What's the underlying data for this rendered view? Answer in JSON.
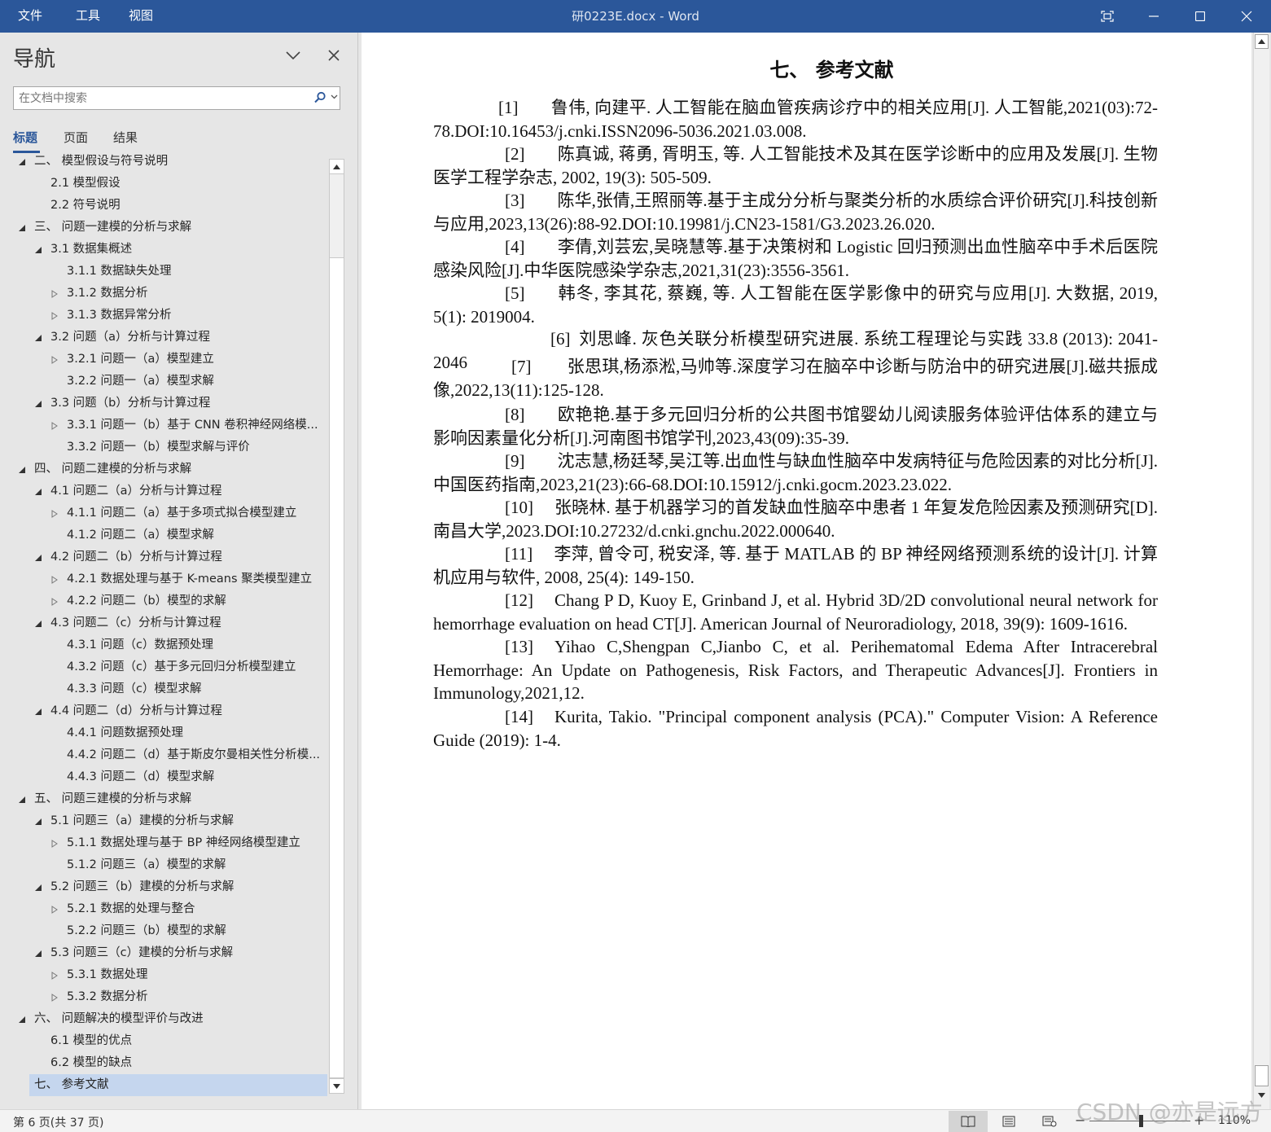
{
  "titlebar": {
    "menus": [
      "文件",
      "工具",
      "视图"
    ],
    "doc_title": "研0223E.docx  -  Word",
    "accent": "#2b579a"
  },
  "nav": {
    "title": "导航",
    "search_placeholder": "在文档中搜索",
    "tabs": [
      "标题",
      "页面",
      "结果"
    ],
    "tree": [
      {
        "label": "二、 模型假设与符号说明",
        "level": 1,
        "toggle": "expanded"
      },
      {
        "label": "2.1 模型假设",
        "level": 2,
        "toggle": "none"
      },
      {
        "label": "2.2 符号说明",
        "level": 2,
        "toggle": "none"
      },
      {
        "label": "三、 问题一建模的分析与求解",
        "level": 1,
        "toggle": "expanded"
      },
      {
        "label": "3.1 数据集概述",
        "level": 2,
        "toggle": "expanded"
      },
      {
        "label": "3.1.1 数据缺失处理",
        "level": 3,
        "toggle": "none"
      },
      {
        "label": "3.1.2 数据分析",
        "level": 3,
        "toggle": "collapsed"
      },
      {
        "label": "3.1.3 数据异常分析",
        "level": 3,
        "toggle": "collapsed"
      },
      {
        "label": "3.2 问题（a）分析与计算过程",
        "level": 2,
        "toggle": "expanded"
      },
      {
        "label": "3.2.1 问题一（a）模型建立",
        "level": 3,
        "toggle": "collapsed"
      },
      {
        "label": "3.2.2 问题一（a）模型求解",
        "level": 3,
        "toggle": "none"
      },
      {
        "label": "3.3 问题（b）分析与计算过程",
        "level": 2,
        "toggle": "expanded"
      },
      {
        "label": "3.3.1 问题一（b）基于 CNN 卷积神经网络模...",
        "level": 3,
        "toggle": "collapsed"
      },
      {
        "label": "3.3.2 问题一（b）模型求解与评价",
        "level": 3,
        "toggle": "none"
      },
      {
        "label": "四、 问题二建模的分析与求解",
        "level": 1,
        "toggle": "expanded"
      },
      {
        "label": "4.1 问题二（a）分析与计算过程",
        "level": 2,
        "toggle": "expanded"
      },
      {
        "label": "4.1.1 问题二（a）基于多项式拟合模型建立",
        "level": 3,
        "toggle": "collapsed"
      },
      {
        "label": "4.1.2 问题二（a）模型求解",
        "level": 3,
        "toggle": "none"
      },
      {
        "label": "4.2 问题二（b）分析与计算过程",
        "level": 2,
        "toggle": "expanded"
      },
      {
        "label": "4.2.1 数据处理与基于 K-means 聚类模型建立",
        "level": 3,
        "toggle": "collapsed"
      },
      {
        "label": "4.2.2 问题二（b）模型的求解",
        "level": 3,
        "toggle": "collapsed"
      },
      {
        "label": "4.3 问题二（c）分析与计算过程",
        "level": 2,
        "toggle": "expanded"
      },
      {
        "label": "4.3.1 问题（c）数据预处理",
        "level": 3,
        "toggle": "none"
      },
      {
        "label": "4.3.2 问题（c）基于多元回归分析模型建立",
        "level": 3,
        "toggle": "none"
      },
      {
        "label": "4.3.3 问题（c）模型求解",
        "level": 3,
        "toggle": "none"
      },
      {
        "label": "4.4 问题二（d）分析与计算过程",
        "level": 2,
        "toggle": "expanded"
      },
      {
        "label": "4.4.1 问题数据预处理",
        "level": 3,
        "toggle": "none"
      },
      {
        "label": "4.4.2 问题二（d）基于斯皮尔曼相关性分析模...",
        "level": 3,
        "toggle": "none"
      },
      {
        "label": "4.4.3 问题二（d）模型求解",
        "level": 3,
        "toggle": "none"
      },
      {
        "label": "五、 问题三建模的分析与求解",
        "level": 1,
        "toggle": "expanded"
      },
      {
        "label": "5.1 问题三（a）建模的分析与求解",
        "level": 2,
        "toggle": "expanded"
      },
      {
        "label": "5.1.1 数据处理与基于 BP 神经网络模型建立",
        "level": 3,
        "toggle": "collapsed"
      },
      {
        "label": "5.1.2 问题三（a）模型的求解",
        "level": 3,
        "toggle": "none"
      },
      {
        "label": "5.2 问题三（b）建模的分析与求解",
        "level": 2,
        "toggle": "expanded"
      },
      {
        "label": "5.2.1 数据的处理与整合",
        "level": 3,
        "toggle": "collapsed"
      },
      {
        "label": "5.2.2 问题三（b）模型的求解",
        "level": 3,
        "toggle": "none"
      },
      {
        "label": "5.3 问题三（c）建模的分析与求解",
        "level": 2,
        "toggle": "expanded"
      },
      {
        "label": "5.3.1 数据处理",
        "level": 3,
        "toggle": "collapsed"
      },
      {
        "label": "5.3.2 数据分析",
        "level": 3,
        "toggle": "collapsed"
      },
      {
        "label": "六、 问题解决的模型评价与改进",
        "level": 1,
        "toggle": "expanded"
      },
      {
        "label": "6.1 模型的优点",
        "level": 2,
        "toggle": "none"
      },
      {
        "label": "6.2 模型的缺点",
        "level": 2,
        "toggle": "none"
      },
      {
        "label": "七、 参考文献",
        "level": 1,
        "toggle": "none",
        "selected": true
      }
    ]
  },
  "document": {
    "heading": "七、 参考文献",
    "references": [
      {
        "num": "[1]",
        "text": "鲁伟, 向建平. 人工智能在脑血管疾病诊疗中的相关应用[J]. 人工智能,2021(03):72-78.DOI:10.16453/j.cnki.ISSN2096-5036.2021.03.008."
      },
      {
        "num": "[2]",
        "text": "陈真诚, 蒋勇, 胥明玉, 等. 人工智能技术及其在医学诊断中的应用及发展[J]. 生物医学工程学杂志, 2002, 19(3): 505-509."
      },
      {
        "num": "[3]",
        "text": "陈华,张倩,王照丽等.基于主成分分析与聚类分析的水质综合评价研究[J].科技创新与应用,2023,13(26):88-92.DOI:10.19981/j.CN23-1581/G3.2023.26.020."
      },
      {
        "num": "[4]",
        "text": "李倩,刘芸宏,吴晓慧等.基于决策树和 Logistic 回归预测出血性脑卒中手术后医院感染风险[J].中华医院感染学杂志,2021,31(23):3556-3561."
      },
      {
        "num": "[5]",
        "text": "韩冬, 李其花, 蔡巍, 等. 人工智能在医学影像中的研究与应用[J]. 大数据, 2019, 5(1): 2019004."
      },
      {
        "num": "[6]",
        "text": "刘思峰. 灰色关联分析模型研究进展. 系统工程理论与实践 33.8 (2013): 2041-2046"
      },
      {
        "num": "[7]",
        "text": "张思琪,杨添淞,马帅等.深度学习在脑卒中诊断与防治中的研究进展[J].磁共振成像,2022,13(11):125-128."
      },
      {
        "num": "[8]",
        "text": "欧艳艳.基于多元回归分析的公共图书馆婴幼儿阅读服务体验评估体系的建立与影响因素量化分析[J].河南图书馆学刊,2023,43(09):35-39."
      },
      {
        "num": "[9]",
        "text": "沈志慧,杨廷琴,吴江等.出血性与缺血性脑卒中发病特征与危险因素的对比分析[J].中国医药指南,2023,21(23):66-68.DOI:10.15912/j.cnki.gocm.2023.23.022."
      },
      {
        "num": "[10]",
        "text": "张晓林. 基于机器学习的首发缺血性脑卒中患者 1 年复发危险因素及预测研究[D].南昌大学,2023.DOI:10.27232/d.cnki.gnchu.2022.000640."
      },
      {
        "num": "[11]",
        "text": "李萍, 曾令可, 税安泽, 等. 基于 MATLAB 的 BP 神经网络预测系统的设计[J]. 计算机应用与软件, 2008, 25(4): 149-150."
      },
      {
        "num": "[12]",
        "text": "Chang P D, Kuoy E, Grinband J, et al. Hybrid 3D/2D convolutional neural network for hemorrhage evaluation on head CT[J]. American Journal of Neuroradiology, 2018, 39(9): 1609-1616."
      },
      {
        "num": "[13]",
        "text": "Yihao C,Shengpan C,Jianbo C, et al. Perihematomal Edema After Intracerebral Hemorrhage: An Update on Pathogenesis, Risk Factors, and Therapeutic Advances[J]. Frontiers in Immunology,2021,12."
      },
      {
        "num": "[14]",
        "text": "Kurita, Takio. \"Principal component analysis (PCA).\" Computer Vision: A  Reference Guide (2019): 1-4."
      }
    ]
  },
  "status": {
    "page": "第 6 页(共 37 页)",
    "zoom": "110%",
    "zoom_minus": "−",
    "zoom_plus": "+"
  },
  "watermark": "CSDN @亦是远方"
}
